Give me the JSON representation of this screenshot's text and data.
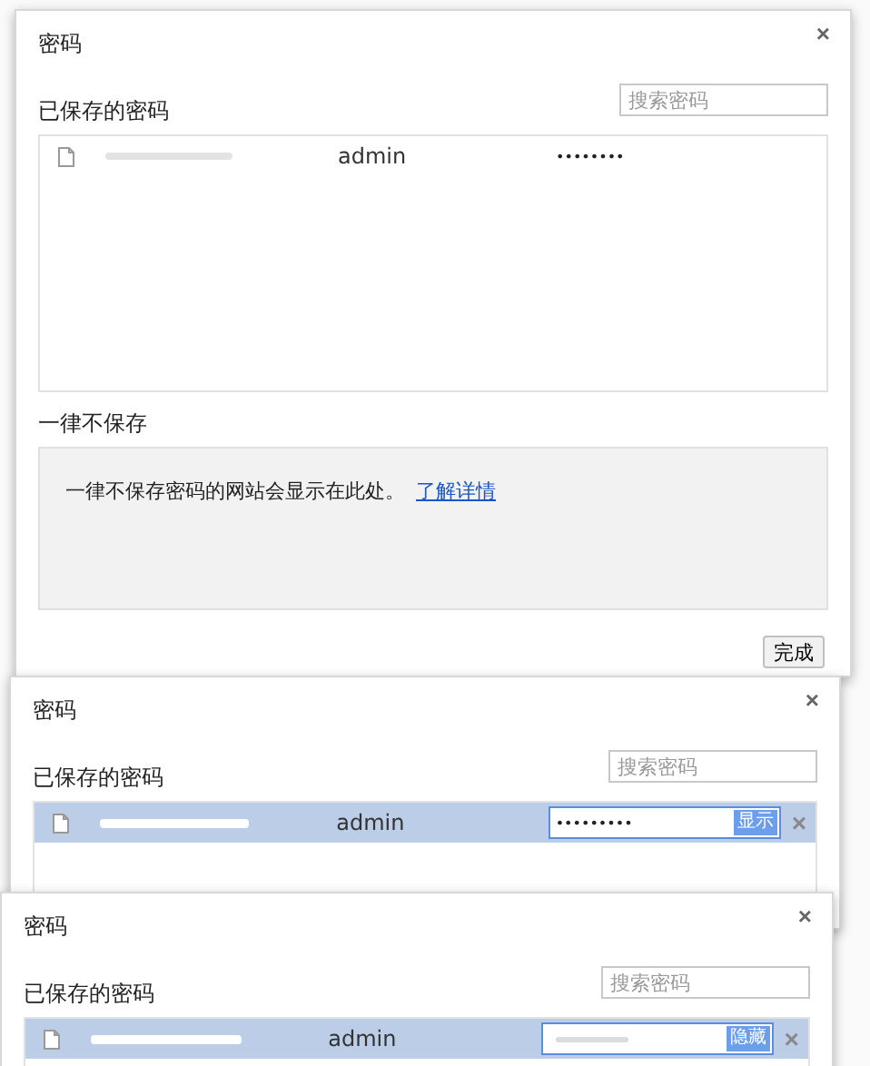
{
  "dialogs": [
    {
      "title": "密码",
      "close": "×",
      "saved_heading": "已保存的密码",
      "search_placeholder": "搜索密码",
      "rows": [
        {
          "username": "admin",
          "password": "••••••••",
          "selected": false,
          "editing": false
        }
      ],
      "never_heading": "一律不保存",
      "never_text": "一律不保存密码的网站会显示在此处。",
      "never_link": "了解详情",
      "done": "完成"
    },
    {
      "title": "密码",
      "close": "×",
      "saved_heading": "已保存的密码",
      "search_placeholder": "搜索密码",
      "rows": [
        {
          "username": "admin",
          "password": "•••••••••",
          "selected": true,
          "editing": true,
          "reveal_button": "显示",
          "delete": "×"
        }
      ]
    },
    {
      "title": "密码",
      "close": "×",
      "saved_heading": "已保存的密码",
      "search_placeholder": "搜索密码",
      "rows": [
        {
          "username": "admin",
          "selected": true,
          "editing": true,
          "reveal_button": "隐藏",
          "delete": "×"
        }
      ]
    }
  ]
}
